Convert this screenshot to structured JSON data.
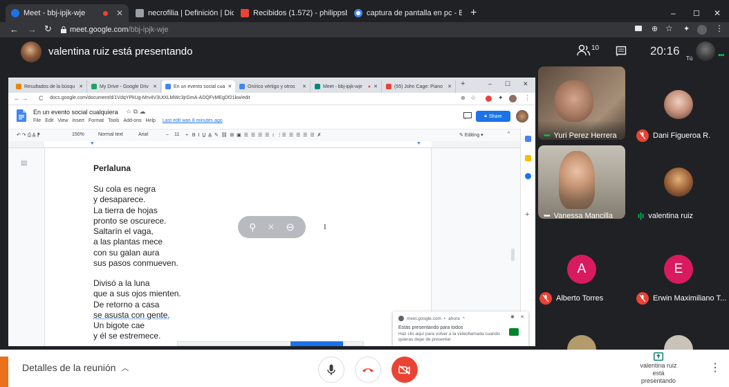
{
  "browser": {
    "tabs": [
      {
        "label": "Meet - bbj-ipjk-wje",
        "color": "#1a73e8"
      },
      {
        "label": "necrofilia | Definición | Diccionari",
        "color": "#9aa0a6"
      },
      {
        "label": "Recibidos (1.572) - philippsburg7",
        "color": "#ea4335"
      },
      {
        "label": "captura de pantalla en pc - Busc",
        "color": "#4285f4"
      }
    ],
    "new_tab": "+",
    "window": {
      "minimize": "–",
      "maximize": "☐",
      "close": "✕"
    },
    "url_host": "meet.google.com",
    "url_path": "/bbj-ipjk-wje"
  },
  "meet": {
    "presenter_banner": "valentina ruiz está presentando",
    "participant_count": "10",
    "time": "20:16",
    "self_label": "Tú"
  },
  "inner_browser": {
    "tabs": [
      {
        "label": "Resultados de la búsqu",
        "color": "#ea8600"
      },
      {
        "label": "My Drive - Google Driv",
        "color": "#1fa463"
      },
      {
        "label": "En un evento social cua",
        "color": "#4285f4"
      },
      {
        "label": "Onírico vértigo y otros",
        "color": "#4285f4"
      },
      {
        "label": "Meet - bbj-ipjk-wje",
        "color": "#00897b"
      },
      {
        "label": "(55) John Cage: Piano",
        "color": "#ea4335"
      }
    ],
    "url": "docs.google.com/document/d/1VdqYPkUg-Mrv4V3UtXLMWc3jrGmA-ADQFvMEgDf21kw/edit"
  },
  "doc": {
    "title": "En un evento social cualquiera",
    "menu": [
      "File",
      "Edit",
      "View",
      "Insert",
      "Format",
      "Tools",
      "Add-ons",
      "Help"
    ],
    "last_edit": "Last edit was 8 minutes ago",
    "share_label": "Share",
    "toolbar": {
      "zoom": "150%",
      "style": "Normal text",
      "font": "Arial",
      "size": "11",
      "mode": "Editing"
    },
    "poem_title": "Perlaluna",
    "stanza1": [
      "Su cola es negra",
      "y desaparece.",
      "La tierra de hojas",
      "pronto se oscurece.",
      "Saltarín el vaga,",
      "a las plantas mece",
      "con su galan aura",
      "sus pasos conmueven."
    ],
    "stanza2": [
      "Divisó a la luna",
      "que a sus ojos mienten.",
      "De retorno a casa",
      "se asusta con gente.",
      "Un bigote cae",
      "y él se estremece."
    ]
  },
  "notification": {
    "source": "meet.google.com",
    "time": "ahora",
    "title": "Estás presentando para todos",
    "body": "Haz clic aquí para volver a la videollamada cuando quieras dejar de presentar"
  },
  "participants": [
    {
      "name": "Yuri Perez Herrera"
    },
    {
      "name": "Dani Figueroa R."
    },
    {
      "name": "Vanessa Mancilla"
    },
    {
      "name": "valentina ruiz"
    },
    {
      "name": "Alberto Torres",
      "initial": "A",
      "color": "#d81b60"
    },
    {
      "name": "Erwin Maximiliano T...",
      "initial": "E",
      "color": "#d81b60"
    }
  ],
  "bottom": {
    "details": "Detalles de la reunión",
    "presenting_line1": "valentina ruiz",
    "presenting_line2": "está presentando"
  },
  "colors": {
    "end_call": "#ea4335",
    "doc_blue": "#1a73e8"
  }
}
